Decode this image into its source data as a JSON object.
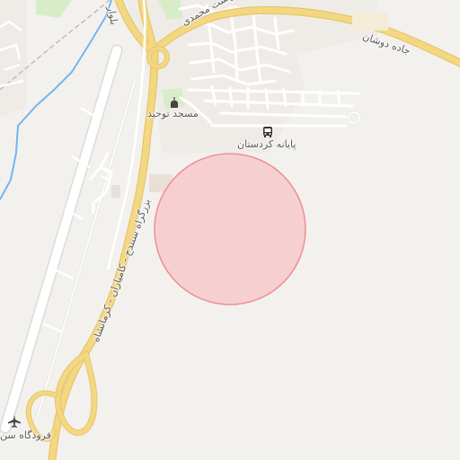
{
  "map": {
    "labels": {
      "boulevard": "بلوار",
      "bahesht_mohammadi": "بلوار بهشت محمدی",
      "dowshan_road": "جاده دوشان",
      "mosque": "مسجد توحید",
      "terminal": "پایانه کردستان",
      "highway": "بزرگراه سنندج - کامیاران - کرمانشاه",
      "airport": "فرودگاه سن"
    },
    "icons": {
      "mosque": "mosque-icon",
      "terminal": "bus-icon",
      "airport": "airplane-icon"
    },
    "colors": {
      "background": "#f3f1ee",
      "highway": "#f3d783",
      "highway_casing": "#e8c66a",
      "minor_road": "#ffffff",
      "river": "#74b5ef",
      "park": "#d8ecc8",
      "highlight_fill": "#f6c9cb",
      "highlight_stroke": "#ef8f93"
    }
  }
}
